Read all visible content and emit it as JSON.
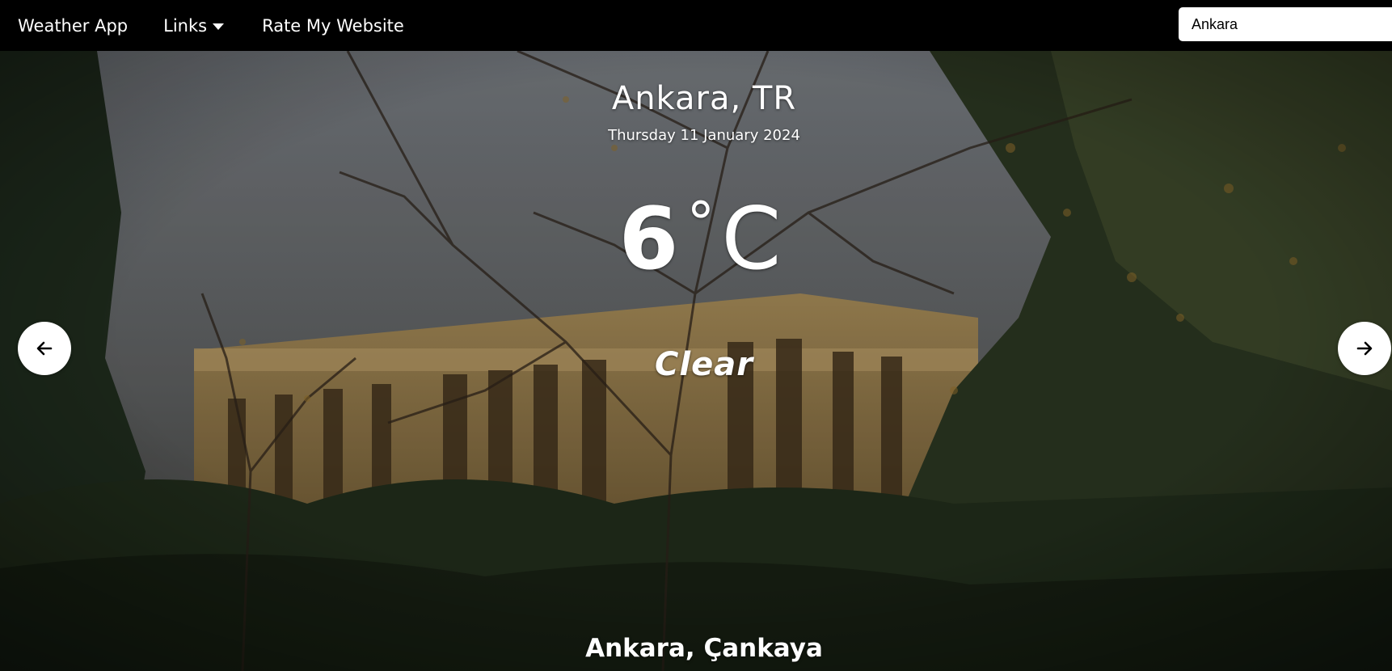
{
  "nav": {
    "brand": "Weather App",
    "links_label": "Links",
    "rate_label": "Rate My Website"
  },
  "search": {
    "value": "Ankara"
  },
  "weather": {
    "city": "Ankara, TR",
    "date": "Thursday 11 January 2024",
    "temp_value": "6",
    "temp_degree": "°",
    "temp_unit": "C",
    "condition": "Clear",
    "location": "Ankara, Çankaya"
  },
  "icons": {
    "links_caret": "caret-down-icon",
    "prev": "arrow-left-icon",
    "next": "arrow-right-icon"
  },
  "colors": {
    "navbar_bg": "#000000",
    "text": "#ffffff",
    "button_bg": "#ffffff"
  }
}
